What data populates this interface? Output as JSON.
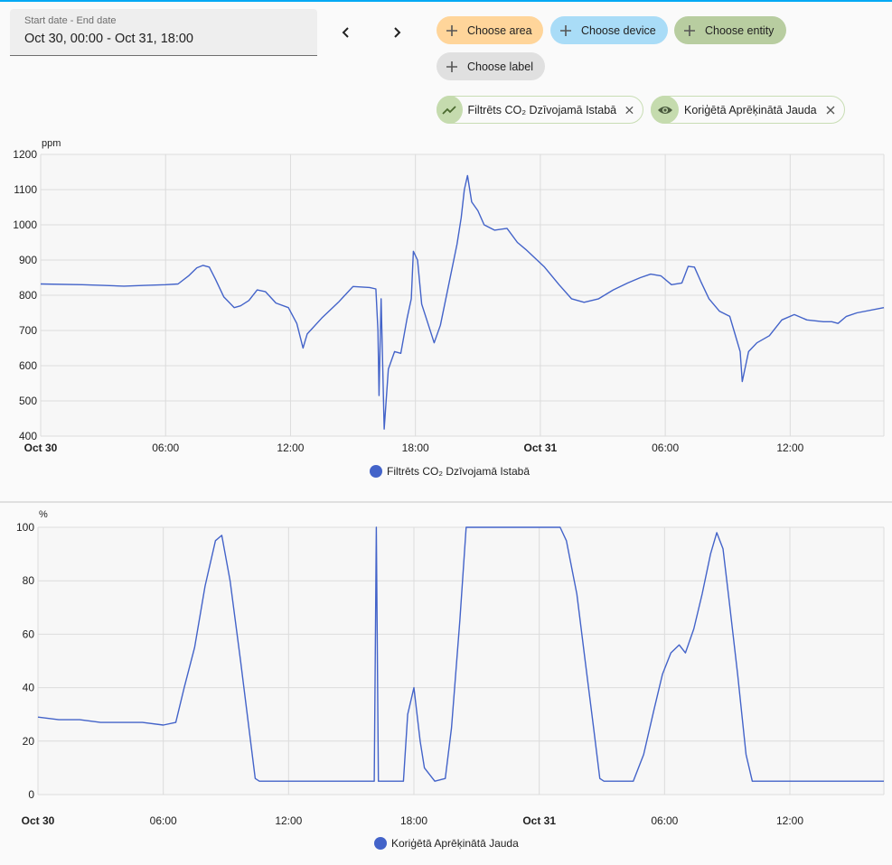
{
  "date_range": {
    "label": "Start date - End date",
    "value": "Oct 30, 00:00 - Oct 31, 18:00"
  },
  "filters": {
    "choose_area": "Choose area",
    "choose_device": "Choose device",
    "choose_entity": "Choose entity",
    "choose_label": "Choose label"
  },
  "selected_entities": [
    {
      "label": "Filtrēts CO₂ Dzīvojamā Istabā",
      "icon": "trend-icon"
    },
    {
      "label": "Koriģētā Aprēķinātā Jauda",
      "icon": "eye-icon"
    }
  ],
  "colors": {
    "series": "#4363c9",
    "area_chip": "#ffd59a",
    "device_chip": "#a9dcf7",
    "entity_chip": "#b8cda0",
    "label_chip": "#e0e0e0",
    "accent": "#03a9f4"
  },
  "chart_data": [
    {
      "type": "line",
      "unit_label": "ppm",
      "ylim": [
        400,
        1200
      ],
      "y_ticks": [
        "1200",
        "1100",
        "1000",
        "900",
        "800",
        "700",
        "600",
        "500",
        "400"
      ],
      "x_ticks": [
        "Oct 30",
        "06:00",
        "12:00",
        "18:00",
        "Oct 31",
        "06:00",
        "12:00"
      ],
      "grid": true,
      "legend": "bottom",
      "series": [
        {
          "name": "Filtrēts CO₂ Dzīvojamā Istabā",
          "points": [
            [
              0,
              832
            ],
            [
              2,
              830
            ],
            [
              3,
              828
            ],
            [
              4,
              826
            ],
            [
              5,
              828
            ],
            [
              6,
              830
            ],
            [
              6.6,
              832
            ],
            [
              7.1,
              855
            ],
            [
              7.5,
              878
            ],
            [
              7.8,
              885
            ],
            [
              8.1,
              880
            ],
            [
              8.4,
              845
            ],
            [
              8.8,
              795
            ],
            [
              9.3,
              765
            ],
            [
              9.6,
              770
            ],
            [
              10.0,
              785
            ],
            [
              10.4,
              815
            ],
            [
              10.8,
              810
            ],
            [
              11.3,
              778
            ],
            [
              11.9,
              765
            ],
            [
              12.3,
              720
            ],
            [
              12.6,
              650
            ],
            [
              12.8,
              690
            ],
            [
              13.5,
              735
            ],
            [
              14.3,
              780
            ],
            [
              15.0,
              825
            ],
            [
              15.8,
              822
            ],
            [
              16.1,
              818
            ],
            [
              16.2,
              700
            ],
            [
              16.25,
              515
            ],
            [
              16.35,
              790
            ],
            [
              16.45,
              540
            ],
            [
              16.5,
              420
            ],
            [
              16.7,
              590
            ],
            [
              17.0,
              640
            ],
            [
              17.3,
              635
            ],
            [
              17.6,
              735
            ],
            [
              17.8,
              790
            ],
            [
              17.9,
              925
            ],
            [
              18.1,
              900
            ],
            [
              18.3,
              775
            ],
            [
              18.6,
              720
            ],
            [
              18.9,
              665
            ],
            [
              19.2,
              715
            ],
            [
              19.6,
              830
            ],
            [
              20.0,
              945
            ],
            [
              20.2,
              1020
            ],
            [
              20.35,
              1100
            ],
            [
              20.5,
              1140
            ],
            [
              20.7,
              1065
            ],
            [
              21.0,
              1040
            ],
            [
              21.3,
              1000
            ],
            [
              21.8,
              985
            ],
            [
              22.4,
              990
            ],
            [
              22.9,
              950
            ],
            [
              23.3,
              930
            ],
            [
              24.2,
              880
            ],
            [
              24.9,
              830
            ],
            [
              25.5,
              790
            ],
            [
              26.1,
              780
            ],
            [
              26.8,
              790
            ],
            [
              27.5,
              815
            ],
            [
              28.2,
              835
            ],
            [
              28.8,
              850
            ],
            [
              29.3,
              860
            ],
            [
              29.8,
              855
            ],
            [
              30.3,
              830
            ],
            [
              30.8,
              835
            ],
            [
              31.1,
              882
            ],
            [
              31.4,
              880
            ],
            [
              31.7,
              840
            ],
            [
              32.1,
              790
            ],
            [
              32.6,
              755
            ],
            [
              33.1,
              740
            ],
            [
              33.3,
              700
            ],
            [
              33.6,
              640
            ],
            [
              33.7,
              555
            ],
            [
              34.0,
              640
            ],
            [
              34.4,
              665
            ],
            [
              35.0,
              685
            ],
            [
              35.6,
              730
            ],
            [
              36.2,
              745
            ],
            [
              36.8,
              730
            ],
            [
              37.6,
              725
            ],
            [
              38.0,
              725
            ],
            [
              38.3,
              720
            ],
            [
              38.7,
              740
            ],
            [
              39.2,
              750
            ],
            [
              40.5,
              765
            ]
          ]
        }
      ]
    },
    {
      "type": "line",
      "unit_label": "%",
      "ylim": [
        0,
        100
      ],
      "y_ticks": [
        "100",
        "80",
        "60",
        "40",
        "20",
        "0"
      ],
      "x_ticks": [
        "Oct 30",
        "06:00",
        "12:00",
        "18:00",
        "Oct 31",
        "06:00",
        "12:00"
      ],
      "grid": true,
      "legend": "bottom",
      "series": [
        {
          "name": "Koriģētā Aprēķinātā Jauda",
          "points": [
            [
              0,
              29
            ],
            [
              1,
              28
            ],
            [
              2,
              28
            ],
            [
              3,
              27
            ],
            [
              4,
              27
            ],
            [
              5,
              27
            ],
            [
              6,
              26
            ],
            [
              6.6,
              27
            ],
            [
              7.0,
              40
            ],
            [
              7.5,
              55
            ],
            [
              8.0,
              78
            ],
            [
              8.5,
              95
            ],
            [
              8.8,
              97
            ],
            [
              9.2,
              80
            ],
            [
              9.7,
              50
            ],
            [
              10.1,
              25
            ],
            [
              10.4,
              6
            ],
            [
              10.6,
              5
            ],
            [
              16.1,
              5
            ],
            [
              16.2,
              100
            ],
            [
              16.3,
              5
            ],
            [
              17.5,
              5
            ],
            [
              17.7,
              30
            ],
            [
              18.0,
              40
            ],
            [
              18.3,
              20
            ],
            [
              18.5,
              10
            ],
            [
              19.0,
              5
            ],
            [
              19.5,
              6
            ],
            [
              19.8,
              25
            ],
            [
              20.2,
              65
            ],
            [
              20.5,
              100
            ],
            [
              21.5,
              100
            ],
            [
              22.5,
              100
            ],
            [
              23.5,
              100
            ],
            [
              24.5,
              100
            ],
            [
              25.0,
              100
            ],
            [
              25.3,
              95
            ],
            [
              25.8,
              75
            ],
            [
              26.2,
              50
            ],
            [
              26.6,
              25
            ],
            [
              26.9,
              6
            ],
            [
              27.1,
              5
            ],
            [
              28.5,
              5
            ],
            [
              29.0,
              15
            ],
            [
              29.5,
              32
            ],
            [
              29.9,
              45
            ],
            [
              30.3,
              53
            ],
            [
              30.7,
              56
            ],
            [
              31.0,
              53
            ],
            [
              31.4,
              62
            ],
            [
              31.8,
              75
            ],
            [
              32.2,
              90
            ],
            [
              32.5,
              98
            ],
            [
              32.8,
              92
            ],
            [
              33.1,
              72
            ],
            [
              33.5,
              45
            ],
            [
              33.9,
              15
            ],
            [
              34.2,
              5
            ],
            [
              40.5,
              5
            ]
          ]
        }
      ]
    }
  ]
}
